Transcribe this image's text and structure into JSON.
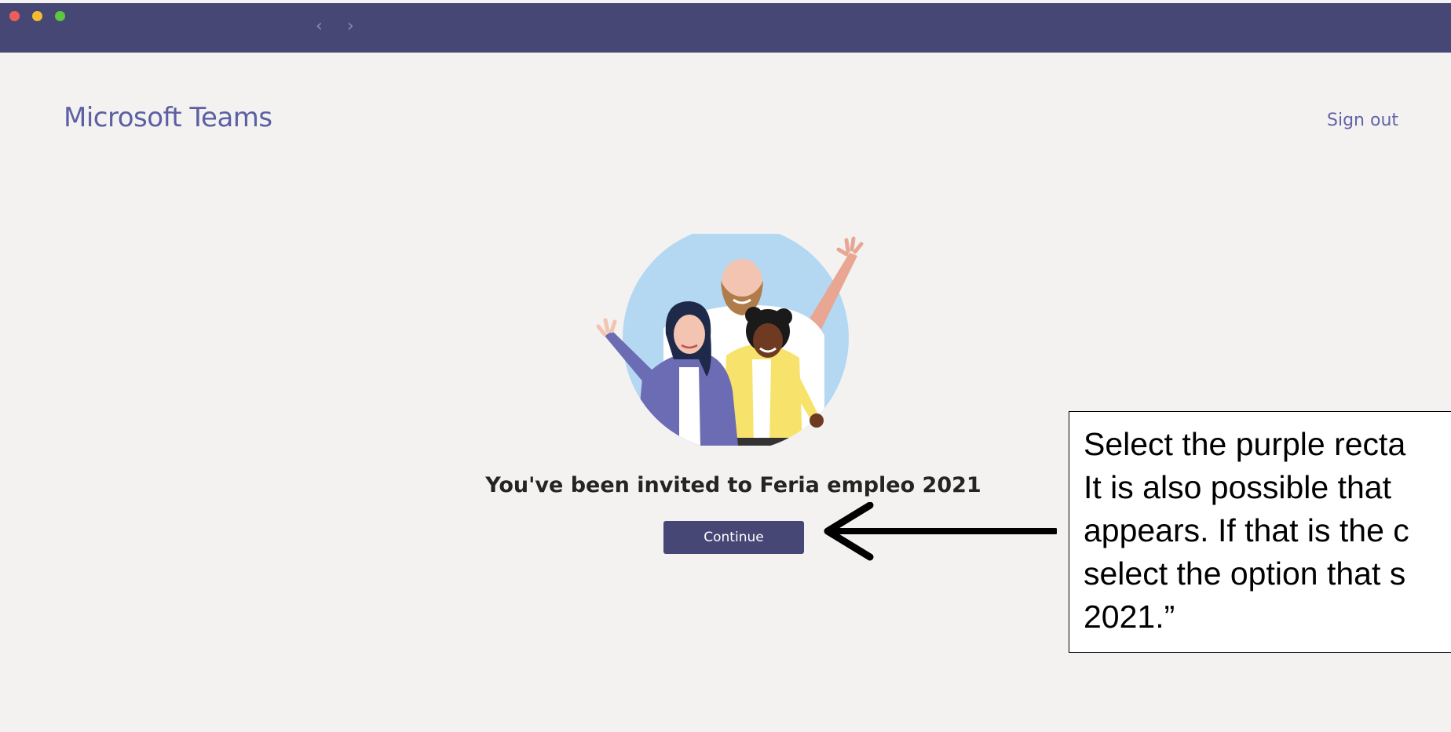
{
  "window": {
    "back_label": "‹",
    "forward_label": "›"
  },
  "header": {
    "app_title": "Microsoft Teams",
    "sign_out_label": "Sign out"
  },
  "main": {
    "illustration_icon": "team-people-illustration",
    "invite_text": "You've been invited to Feria empleo 2021",
    "continue_label": "Continue"
  },
  "annotation": {
    "arrow_icon": "left-arrow-icon",
    "lines": [
      "Select the purple recta",
      "It is also possible that",
      "appears. If that is the c",
      "select the option that s",
      "2021.”"
    ]
  },
  "colors": {
    "titlebar": "#464775",
    "accent": "#6264a7",
    "background": "#f3f2f1"
  }
}
